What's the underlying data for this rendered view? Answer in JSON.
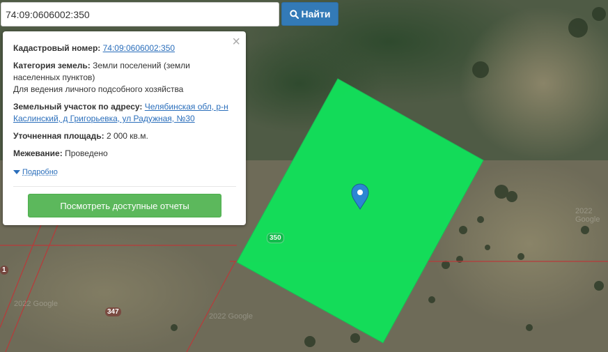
{
  "search": {
    "value": "74:09:0606002:350",
    "button_label": "Найти"
  },
  "popup": {
    "cadastral_label": "Кадастровый номер:",
    "cadastral_value": "74:09:0606002:350",
    "category_label": "Категория земель:",
    "category_value": "Земли поселений (земли населенных пунктов)",
    "category_use": "Для ведения личного подсобного хозяйства",
    "address_label": "Земельный участок по адресу:",
    "address_value": "Челябинская обл, р-н Каслинский, д Григорьевка, ул Радужная, №30",
    "area_label": "Уточненная площадь:",
    "area_value": "2 000 кв.м.",
    "survey_label": "Межевание:",
    "survey_value": "Проведено",
    "details_link": "Подробно",
    "reports_button": "Посмотреть доступные отчеты",
    "close_symbol": "×"
  },
  "map": {
    "parcel_color": "#12e05a",
    "boundary_color": "#b83a3a",
    "labels": {
      "parcel": "350",
      "neighbor": "347",
      "edge": "1"
    },
    "watermarks": [
      "2022 Google",
      "2022 Google",
      "2022 Google"
    ]
  }
}
